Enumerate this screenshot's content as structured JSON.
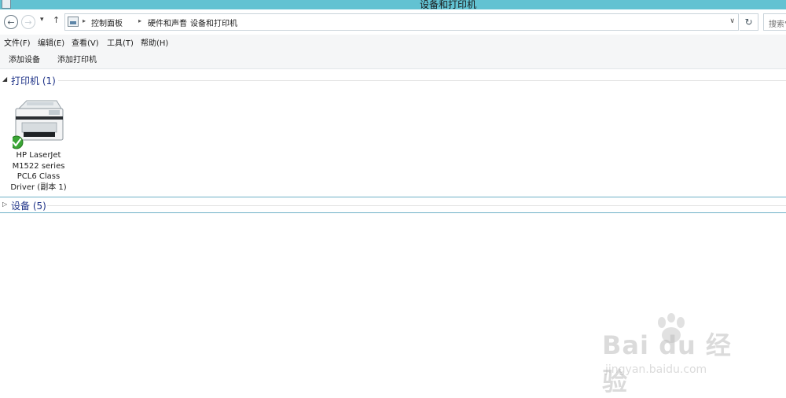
{
  "window": {
    "title": "设备和打印机"
  },
  "navigation": {
    "back": "←",
    "forward": "→",
    "recent": "▾",
    "up": "↑",
    "breadcrumb": [
      "控制面板",
      "硬件和声音",
      "设备和打印机"
    ],
    "breadcrumb_separator": "▸",
    "dropdown_glyph": "∨",
    "refresh_glyph": "↻",
    "search_placeholder": "搜索\""
  },
  "menu": {
    "file": "文件(F)",
    "edit": "编辑(E)",
    "view": "查看(V)",
    "tools": "工具(T)",
    "help": "帮助(H)"
  },
  "toolbar": {
    "add_device": "添加设备",
    "add_printer": "添加打印机"
  },
  "groups": {
    "printers": {
      "label": "打印机 (1)",
      "expanded": true,
      "items": [
        {
          "name_lines": [
            "HP LaserJet",
            "M1522 series",
            "PCL6 Class",
            "Driver (副本 1)"
          ],
          "status": "default",
          "icon": "printer-icon"
        }
      ]
    },
    "devices": {
      "label": "设备 (5)",
      "expanded": false
    }
  },
  "watermark": {
    "logo": "Bai du 经验",
    "url": "jingyan.baidu.com"
  }
}
